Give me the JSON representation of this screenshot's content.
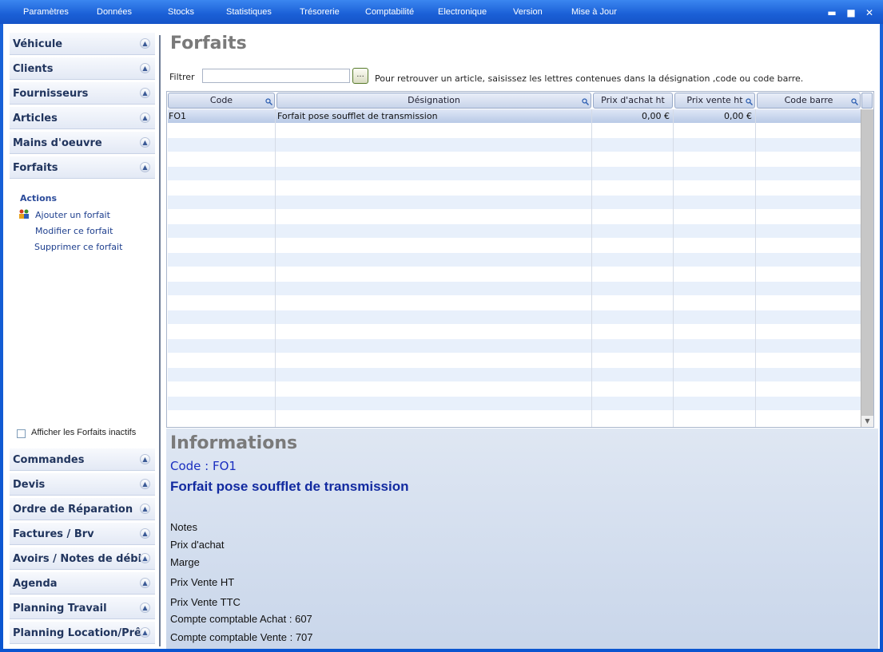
{
  "menu": {
    "items": [
      "Paramètres",
      "Données",
      "Stocks",
      "Statistiques",
      "Trésorerie",
      "Comptabilité",
      "Electronique",
      "Version",
      "Mise à Jour"
    ]
  },
  "window_controls": {
    "minimize": "▬",
    "maximize": "■",
    "close": "✕"
  },
  "sidebar": {
    "top_sections": [
      "Véhicule",
      "Clients",
      "Fournisseurs",
      "Articles",
      "Mains d'oeuvre",
      "Forfaits"
    ],
    "actions_title": "Actions",
    "actions": [
      "Ajouter un forfait",
      "Modifier ce forfait",
      "Supprimer ce forfait"
    ],
    "inactive_label": "Afficher les Forfaits inactifs",
    "bottom_sections": [
      "Commandes",
      "Devis",
      "Ordre de Réparation",
      "Factures / Brv",
      "Avoirs / Notes de débit",
      "Agenda",
      "Planning Travail",
      "Planning Location/Prêt"
    ]
  },
  "main": {
    "title": "Forfaits",
    "filter_label": "Filtrer",
    "filter_value": "",
    "filter_button": "...",
    "filter_hint": "Pour retrouver un article, saisissez les lettres contenues dans la désignation ,code ou code barre."
  },
  "grid": {
    "columns": [
      "Code",
      "Désignation",
      "Prix d'achat ht",
      "Prix vente ht",
      "Code barre"
    ],
    "rows": [
      {
        "code": "FO1",
        "designation": "Forfait pose soufflet de transmission",
        "prix_achat": "0,00 €",
        "prix_vente": "0,00 €",
        "code_barre": ""
      }
    ]
  },
  "info": {
    "title": "Informations",
    "code": "Code : FO1",
    "designation": "Forfait pose soufflet de transmission",
    "notes": "Notes",
    "prix_achat": "Prix d'achat",
    "marge": "Marge",
    "prix_vente_ht": "Prix Vente HT",
    "prix_vente_ttc": "Prix Vente TTC",
    "compte_achat": "Compte comptable Achat : 607",
    "compte_vente": "Compte comptable Vente : 707"
  },
  "colors": {
    "menubar": "#1a5fd6",
    "accent": "#122aa0",
    "info_bg": "#dfe7f3"
  }
}
